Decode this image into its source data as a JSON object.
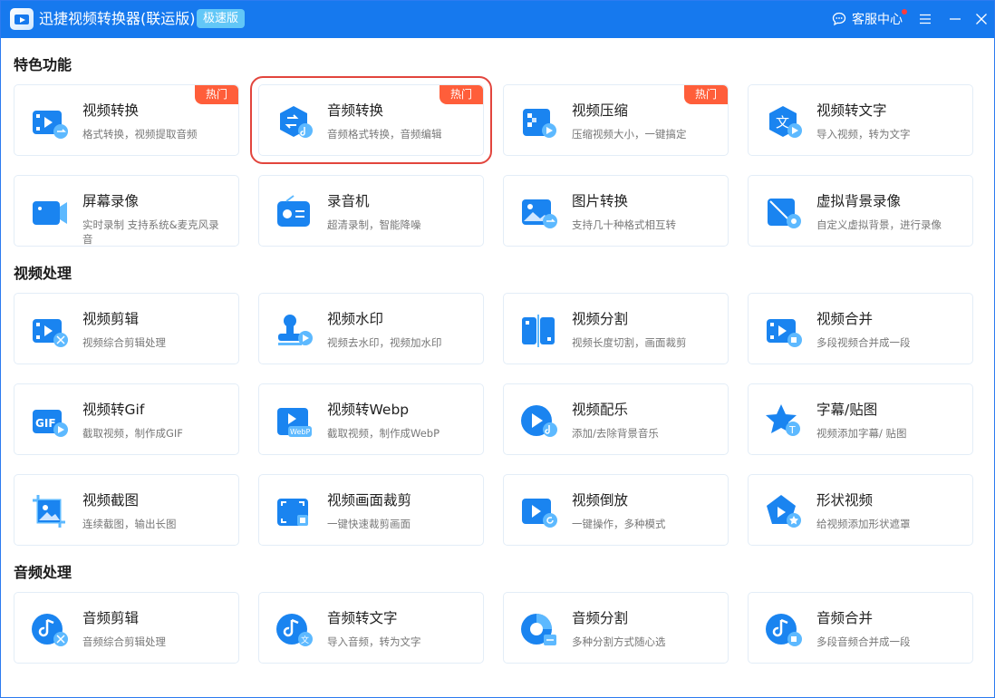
{
  "app": {
    "title": "迅捷视频转换器(联运版)",
    "edition_badge": "极速版",
    "support_label": "客服中心",
    "accent": "#1679ee",
    "hot_color": "#ff5e3a"
  },
  "sections": [
    {
      "title": "特色功能"
    },
    {
      "title": "视频处理"
    },
    {
      "title": "音频处理"
    }
  ],
  "hot_label": "热门",
  "features": [
    {
      "name": "视频转换",
      "desc": "格式转换，视频提取音频",
      "icon": "video-convert-icon",
      "hot": true
    },
    {
      "name": "音频转换",
      "desc": "音频格式转换，音频编辑",
      "icon": "audio-convert-icon",
      "hot": true,
      "selected": true
    },
    {
      "name": "视频压缩",
      "desc": "压缩视频大小，一键搞定",
      "icon": "video-compress-icon",
      "hot": true
    },
    {
      "name": "视频转文字",
      "desc": "导入视频，转为文字",
      "icon": "video-to-text-icon"
    },
    {
      "name": "屏幕录像",
      "desc": "实时录制 支持系统&麦克风录音",
      "icon": "screen-record-icon"
    },
    {
      "name": "录音机",
      "desc": "超清录制，智能降噪",
      "icon": "recorder-icon"
    },
    {
      "name": "图片转换",
      "desc": "支持几十种格式相互转",
      "icon": "image-convert-icon"
    },
    {
      "name": "虚拟背景录像",
      "desc": "自定义虚拟背景，进行录像",
      "icon": "virtual-bg-record-icon"
    }
  ],
  "video_tools": [
    {
      "name": "视频剪辑",
      "desc": "视频综合剪辑处理",
      "icon": "video-edit-icon"
    },
    {
      "name": "视频水印",
      "desc": "视频去水印，视频加水印",
      "icon": "watermark-icon"
    },
    {
      "name": "视频分割",
      "desc": "视频长度切割，画面裁剪",
      "icon": "video-split-icon"
    },
    {
      "name": "视频合并",
      "desc": "多段视频合并成一段",
      "icon": "video-merge-icon"
    },
    {
      "name": "视频转Gif",
      "desc": "截取视频，制作成GIF",
      "icon": "gif-icon"
    },
    {
      "name": "视频转Webp",
      "desc": "截取视频，制作成WebP",
      "icon": "webp-icon"
    },
    {
      "name": "视频配乐",
      "desc": "添加/去除背景音乐",
      "icon": "video-music-icon"
    },
    {
      "name": "字幕/贴图",
      "desc": "视频添加字幕/ 贴图",
      "icon": "subtitle-sticker-icon"
    },
    {
      "name": "视频截图",
      "desc": "连续截图，输出长图",
      "icon": "screenshot-icon"
    },
    {
      "name": "视频画面裁剪",
      "desc": "一键快速裁剪画面",
      "icon": "crop-icon"
    },
    {
      "name": "视频倒放",
      "desc": "一键操作，多种模式",
      "icon": "reverse-icon"
    },
    {
      "name": "形状视频",
      "desc": "给视频添加形状遮罩",
      "icon": "shape-video-icon"
    }
  ],
  "audio_tools": [
    {
      "name": "音频剪辑",
      "desc": "音频综合剪辑处理",
      "icon": "audio-edit-icon"
    },
    {
      "name": "音频转文字",
      "desc": "导入音频，转为文字",
      "icon": "audio-to-text-icon"
    },
    {
      "name": "音频分割",
      "desc": "多种分割方式随心选",
      "icon": "audio-split-icon"
    },
    {
      "name": "音频合并",
      "desc": "多段音频合并成一段",
      "icon": "audio-merge-icon"
    }
  ]
}
